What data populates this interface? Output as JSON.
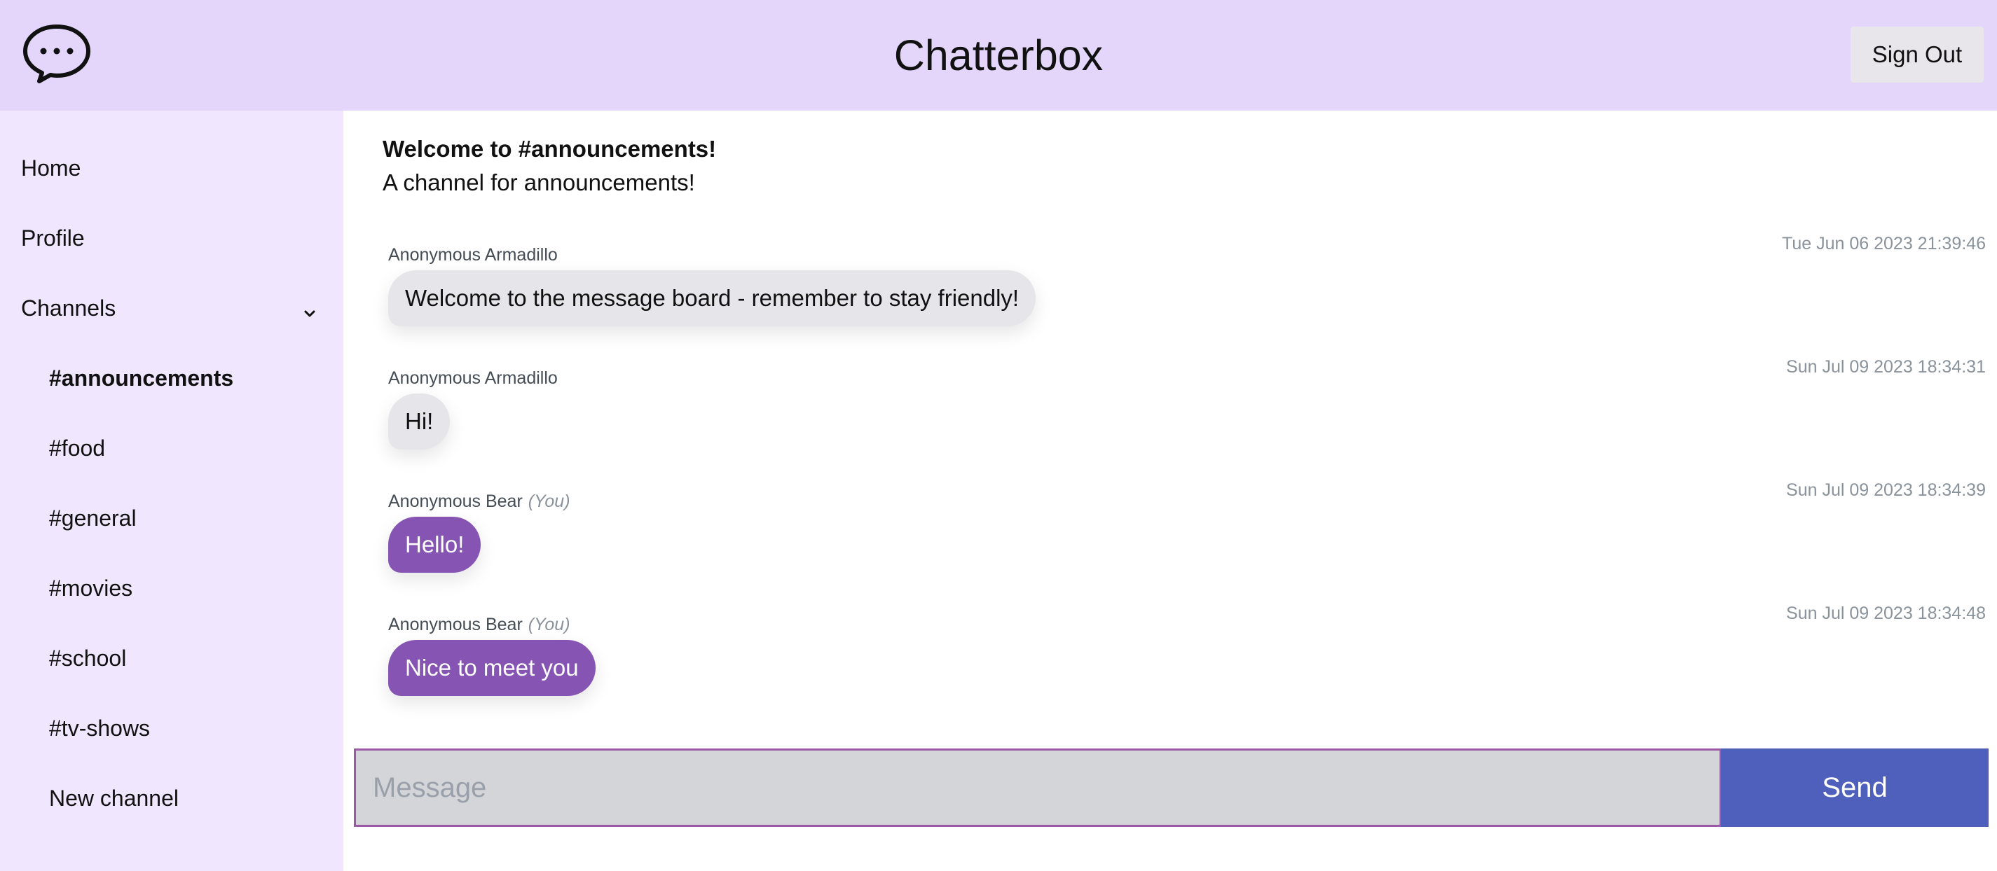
{
  "header": {
    "title": "Chatterbox",
    "logo_icon": "speech-bubble-ellipsis-icon",
    "sign_out_label": "Sign Out"
  },
  "sidebar": {
    "home_label": "Home",
    "profile_label": "Profile",
    "channels_label": "Channels",
    "channels": [
      {
        "label": "#announcements",
        "active": true
      },
      {
        "label": "#food",
        "active": false
      },
      {
        "label": "#general",
        "active": false
      },
      {
        "label": "#movies",
        "active": false
      },
      {
        "label": "#school",
        "active": false
      },
      {
        "label": "#tv-shows",
        "active": false
      }
    ],
    "new_channel_label": "New channel"
  },
  "channel": {
    "welcome_title": "Welcome to #announcements!",
    "description": "A channel for announcements!"
  },
  "messages": [
    {
      "author": "Anonymous Armadillo",
      "you": "",
      "timestamp": "Tue Jun 06 2023 21:39:46",
      "text": "Welcome to the message board - remember to stay friendly!",
      "mine": false
    },
    {
      "author": "Anonymous Armadillo",
      "you": "",
      "timestamp": "Sun Jul 09 2023 18:34:31",
      "text": "Hi!",
      "mine": false
    },
    {
      "author": "Anonymous Bear",
      "you": "(You)",
      "timestamp": "Sun Jul 09 2023 18:34:39",
      "text": "Hello!",
      "mine": true
    },
    {
      "author": "Anonymous Bear",
      "you": "(You)",
      "timestamp": "Sun Jul 09 2023 18:34:48",
      "text": "Nice to meet you",
      "mine": true
    }
  ],
  "composer": {
    "placeholder": "Message",
    "value": "",
    "send_label": "Send"
  },
  "colors": {
    "header_bg": "#e4d6fa",
    "sidebar_bg": "#f0e6fd",
    "own_bubble": "#8654b2",
    "other_bubble": "#e6e6ea",
    "send_button": "#4f5fbc",
    "input_border": "#9b5aa6"
  }
}
